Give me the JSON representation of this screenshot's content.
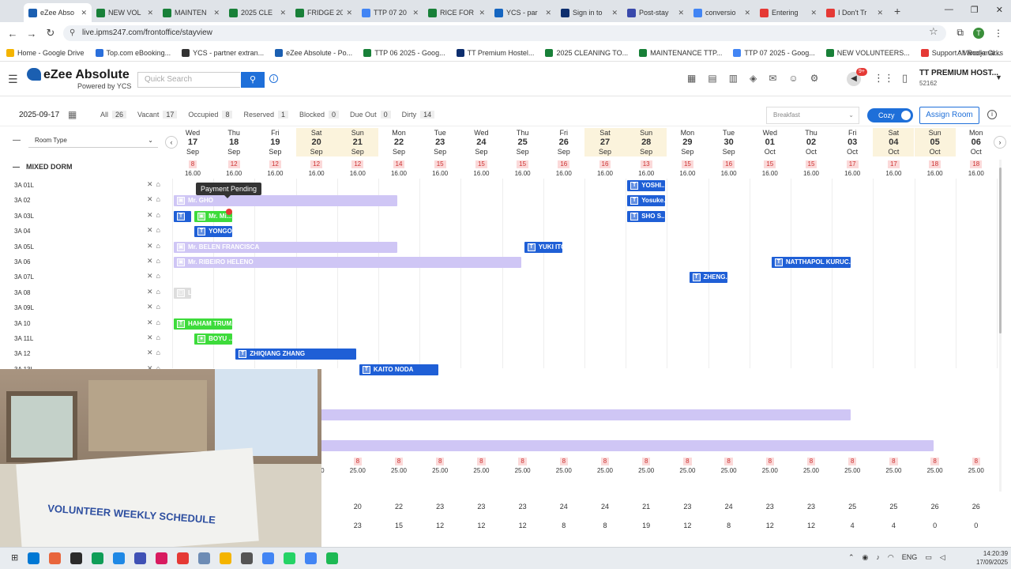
{
  "browser": {
    "tabs": [
      {
        "label": "eZee Abso",
        "color": "#1b5fb1",
        "active": true
      },
      {
        "label": "NEW VOL",
        "color": "#188038"
      },
      {
        "label": "MAINTEN",
        "color": "#188038"
      },
      {
        "label": "2025 CLE",
        "color": "#188038"
      },
      {
        "label": "FRIDGE 20",
        "color": "#188038"
      },
      {
        "label": "TTP 07 20",
        "color": "#4285f4"
      },
      {
        "label": "RICE FOR",
        "color": "#188038"
      },
      {
        "label": "YCS - par",
        "color": "#1565c0"
      },
      {
        "label": "Sign in to",
        "color": "#0d2e6e"
      },
      {
        "label": "Post-stay",
        "color": "#3949ab"
      },
      {
        "label": "conversio",
        "color": "#4285f4"
      },
      {
        "label": "Entering",
        "color": "#e53935"
      },
      {
        "label": "I Don't Tr",
        "color": "#e53935"
      }
    ],
    "url": "live.ipms247.com/frontoffice/stayview",
    "bookmarks": [
      {
        "label": "Home - Google Drive",
        "color": "#f4b400"
      },
      {
        "label": "Top.com eBooking...",
        "color": "#2a6fdb"
      },
      {
        "label": "YCS - partner extran...",
        "color": "#333333"
      },
      {
        "label": "eZee Absolute - Po...",
        "color": "#1b5fb1"
      },
      {
        "label": "TTP 06 2025 - Goog...",
        "color": "#188038"
      },
      {
        "label": "TT Premium Hostel...",
        "color": "#0d2e6e"
      },
      {
        "label": "2025 CLEANING TO...",
        "color": "#188038"
      },
      {
        "label": "MAINTENANCE TTP...",
        "color": "#188038"
      },
      {
        "label": "TTP 07 2025 - Goog...",
        "color": "#4285f4"
      },
      {
        "label": "NEW VOLUNTEERS...",
        "color": "#188038"
      },
      {
        "label": "Support : Vanolja Cl...",
        "color": "#e53935"
      }
    ],
    "all_bookmarks": "All Rookmarks",
    "profile_initial": "T"
  },
  "app": {
    "logo_name": "eZee Absolute",
    "logo_sub": "Powered by YCS",
    "search_placeholder": "Quick Search",
    "notif_count": "9+",
    "hotel_name": "TT PREMIUM HOST...",
    "hotel_id": "52162"
  },
  "filter": {
    "date": "2025-09-17",
    "counts": [
      {
        "label": "All",
        "value": "26"
      },
      {
        "label": "Vacant",
        "value": "17"
      },
      {
        "label": "Occupied",
        "value": "8"
      },
      {
        "label": "Reserved",
        "value": "1"
      },
      {
        "label": "Blocked",
        "value": "0"
      },
      {
        "label": "Due Out",
        "value": "0"
      },
      {
        "label": "Dirty",
        "value": "14"
      }
    ],
    "meal": "Breakfast",
    "cozy": "Cozy",
    "assign": "Assign Room",
    "room_type": "Room Type"
  },
  "dates": [
    {
      "dow": "Wed",
      "d": "17",
      "m": "Sep",
      "we": false
    },
    {
      "dow": "Thu",
      "d": "18",
      "m": "Sep",
      "we": false
    },
    {
      "dow": "Fri",
      "d": "19",
      "m": "Sep",
      "we": false
    },
    {
      "dow": "Sat",
      "d": "20",
      "m": "Sep",
      "we": true
    },
    {
      "dow": "Sun",
      "d": "21",
      "m": "Sep",
      "we": true
    },
    {
      "dow": "Mon",
      "d": "22",
      "m": "Sep",
      "we": false
    },
    {
      "dow": "Tue",
      "d": "23",
      "m": "Sep",
      "we": false
    },
    {
      "dow": "Wed",
      "d": "24",
      "m": "Sep",
      "we": false
    },
    {
      "dow": "Thu",
      "d": "25",
      "m": "Sep",
      "we": false
    },
    {
      "dow": "Fri",
      "d": "26",
      "m": "Sep",
      "we": false
    },
    {
      "dow": "Sat",
      "d": "27",
      "m": "Sep",
      "we": true
    },
    {
      "dow": "Sun",
      "d": "28",
      "m": "Sep",
      "we": true
    },
    {
      "dow": "Mon",
      "d": "29",
      "m": "Sep",
      "we": false
    },
    {
      "dow": "Tue",
      "d": "30",
      "m": "Sep",
      "we": false
    },
    {
      "dow": "Wed",
      "d": "01",
      "m": "Oct",
      "we": false
    },
    {
      "dow": "Thu",
      "d": "02",
      "m": "Oct",
      "we": false
    },
    {
      "dow": "Fri",
      "d": "03",
      "m": "Oct",
      "we": false
    },
    {
      "dow": "Sat",
      "d": "04",
      "m": "Oct",
      "we": true
    },
    {
      "dow": "Sun",
      "d": "05",
      "m": "Oct",
      "we": true
    },
    {
      "dow": "Mon",
      "d": "06",
      "m": "Oct",
      "we": false
    }
  ],
  "section": "MIXED DORM",
  "avail_top": {
    "counts": [
      "8",
      "12",
      "12",
      "12",
      "12",
      "14",
      "15",
      "15",
      "15",
      "16",
      "16",
      "13",
      "15",
      "16",
      "15",
      "15",
      "17",
      "17",
      "18",
      "18"
    ],
    "price": "16.00"
  },
  "rooms": [
    "3A 01L",
    "3A 02",
    "3A 03L",
    "3A 04",
    "3A 05L",
    "3A 06",
    "3A 07L",
    "3A 08",
    "3A 09L",
    "3A 10",
    "3A 11L",
    "3A 12",
    "3A 13L"
  ],
  "bookings": [
    {
      "row": 0,
      "start": 11,
      "span": 1,
      "label": "YOSHI...",
      "style": "blue",
      "tag": "T"
    },
    {
      "row": 1,
      "start": 0,
      "span": 5.5,
      "label": "Mr. GHO",
      "style": "lav",
      "tag": "▣"
    },
    {
      "row": 1,
      "start": 11,
      "span": 1,
      "label": "Yosuke...",
      "style": "blue",
      "tag": "T"
    },
    {
      "row": 2,
      "start": 0,
      "span": 0.5,
      "label": "",
      "style": "blue",
      "tag": "T"
    },
    {
      "row": 2,
      "start": 0.5,
      "span": 1,
      "label": "Mr. Mi...",
      "style": "green",
      "tag": "▣"
    },
    {
      "row": 2,
      "start": 11,
      "span": 1,
      "label": "SHO S...",
      "style": "blue",
      "tag": "T"
    },
    {
      "row": 3,
      "start": 0.5,
      "span": 1,
      "label": "YONGO...",
      "style": "blue",
      "tag": "T"
    },
    {
      "row": 4,
      "start": 0,
      "span": 5.5,
      "label": "Mr. BELEN FRANCISCA",
      "style": "lav",
      "tag": "▣"
    },
    {
      "row": 4,
      "start": 8.5,
      "span": 1,
      "label": "YUKI ITO",
      "style": "blue",
      "tag": "T"
    },
    {
      "row": 5,
      "start": 0,
      "span": 8.5,
      "label": "Mr. RIBEIRO HELENO",
      "style": "lav",
      "tag": "▣"
    },
    {
      "row": 5,
      "start": 14.5,
      "span": 2,
      "label": "NATTHAPOL KURUC...",
      "style": "blue",
      "tag": "T"
    },
    {
      "row": 6,
      "start": 12.5,
      "span": 1,
      "label": "ZHENG...",
      "style": "blue",
      "tag": "T"
    },
    {
      "row": 7,
      "start": 0,
      "span": 0.5,
      "label": "L",
      "style": "grey",
      "tag": "▢"
    },
    {
      "row": 9,
      "start": 0,
      "span": 1.5,
      "label": "HAHAM TRUM...",
      "style": "green",
      "tag": "T"
    },
    {
      "row": 10,
      "start": 0.5,
      "span": 1,
      "label": "BOYU ...",
      "style": "green",
      "tag": "●"
    },
    {
      "row": 11,
      "start": 1.5,
      "span": 3,
      "label": "ZHIQIANG ZHANG",
      "style": "blue",
      "tag": "T"
    },
    {
      "row": 12,
      "start": 4.5,
      "span": 2,
      "label": "KAITO NODA",
      "style": "blue",
      "tag": "T"
    }
  ],
  "lower_bars": [
    {
      "start": 0,
      "span": 16.5,
      "label": ""
    },
    {
      "start": 0,
      "span": 18.5,
      "label": ""
    }
  ],
  "tooltip": "Payment Pending",
  "avail_bottom": {
    "counts": [
      "8",
      "8",
      "8",
      "8",
      "8",
      "8",
      "8",
      "8",
      "8",
      "8",
      "8",
      "8",
      "8",
      "8",
      "8",
      "8",
      "8",
      "8",
      "8",
      "8"
    ],
    "price": "25.00"
  },
  "totals_row1": [
    "",
    "",
    "",
    "",
    "20",
    "22",
    "23",
    "23",
    "23",
    "24",
    "24",
    "21",
    "23",
    "24",
    "23",
    "23",
    "25",
    "25",
    "26",
    "26"
  ],
  "totals_row2": [
    "",
    "",
    "",
    "",
    "23",
    "15",
    "12",
    "12",
    "12",
    "8",
    "8",
    "19",
    "12",
    "8",
    "12",
    "12",
    "4",
    "4",
    "0",
    "0"
  ],
  "webcam": {
    "text": "VOLUNTEER WEEKLY SCHEDULE"
  },
  "taskbar": {
    "apps": [
      "#0078d4",
      "#e8663d",
      "#2b2b2b",
      "#0f9d58",
      "#1e88e5",
      "#3f51b5",
      "#d81b60",
      "#e53935",
      "#6d8cb5",
      "#f4b400",
      "#555555",
      "#4285f4",
      "#25d366",
      "#4285f4",
      "#1db954"
    ],
    "lang": "ENG",
    "time": "14:20:39",
    "date": "17/09/2025"
  }
}
